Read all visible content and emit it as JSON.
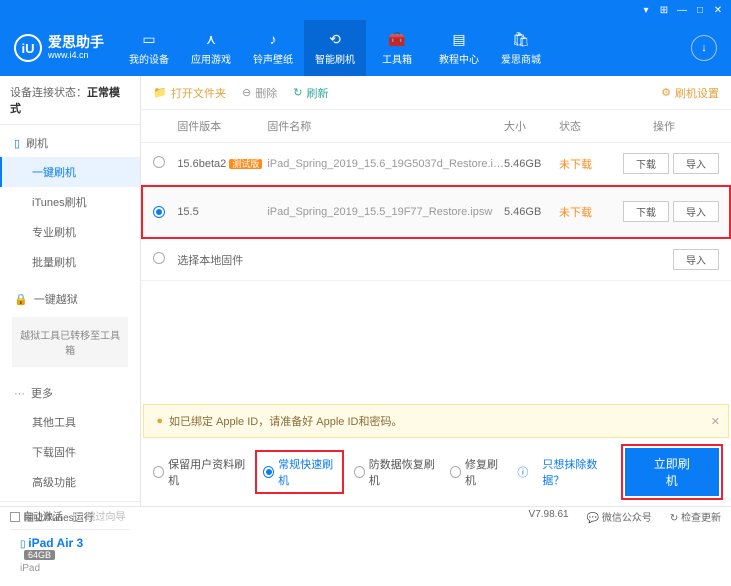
{
  "app": {
    "name": "爱思助手",
    "url": "www.i4.cn"
  },
  "nav": {
    "items": [
      {
        "label": "我的设备"
      },
      {
        "label": "应用游戏"
      },
      {
        "label": "铃声壁纸"
      },
      {
        "label": "智能刷机"
      },
      {
        "label": "工具箱"
      },
      {
        "label": "教程中心"
      },
      {
        "label": "爱思商城"
      }
    ]
  },
  "sidebar": {
    "conn_label": "设备连接状态：",
    "conn_value": "正常模式",
    "groups": {
      "flash": {
        "title": "刷机",
        "items": [
          "一键刷机",
          "iTunes刷机",
          "专业刷机",
          "批量刷机"
        ]
      },
      "jailbreak": {
        "title": "一键越狱",
        "note": "越狱工具已转移至工具箱"
      },
      "more": {
        "title": "更多",
        "items": [
          "其他工具",
          "下载固件",
          "高级功能"
        ]
      }
    },
    "auto_activate": "自动激活",
    "skip_guide": "跳过向导",
    "device": {
      "name": "iPad Air 3",
      "storage": "64GB",
      "type": "iPad"
    }
  },
  "toolbar": {
    "open": "打开文件夹",
    "delete": "删除",
    "refresh": "刷新",
    "settings": "刷机设置"
  },
  "table": {
    "headers": {
      "version": "固件版本",
      "name": "固件名称",
      "size": "大小",
      "status": "状态",
      "ops": "操作"
    },
    "rows": [
      {
        "version": "15.6beta2",
        "beta": "测试版",
        "name": "iPad_Spring_2019_15.6_19G5037d_Restore.i…",
        "size": "5.46GB",
        "status": "未下载",
        "selected": false
      },
      {
        "version": "15.5",
        "name": "iPad_Spring_2019_15.5_19F77_Restore.ipsw",
        "size": "5.46GB",
        "status": "未下载",
        "selected": true
      }
    ],
    "local_row": "选择本地固件",
    "btn_download": "下载",
    "btn_import": "导入"
  },
  "warning": {
    "text": "如已绑定 Apple ID，请准备好 Apple ID和密码。"
  },
  "modes": {
    "opts": [
      "保留用户资料刷机",
      "常规快速刷机",
      "防数据恢复刷机",
      "修复刷机"
    ],
    "link": "只想抹除数据？",
    "action": "立即刷机"
  },
  "statusbar": {
    "block_itunes": "阻止iTunes运行",
    "version": "V7.98.61",
    "wechat": "微信公众号",
    "update": "检查更新"
  }
}
